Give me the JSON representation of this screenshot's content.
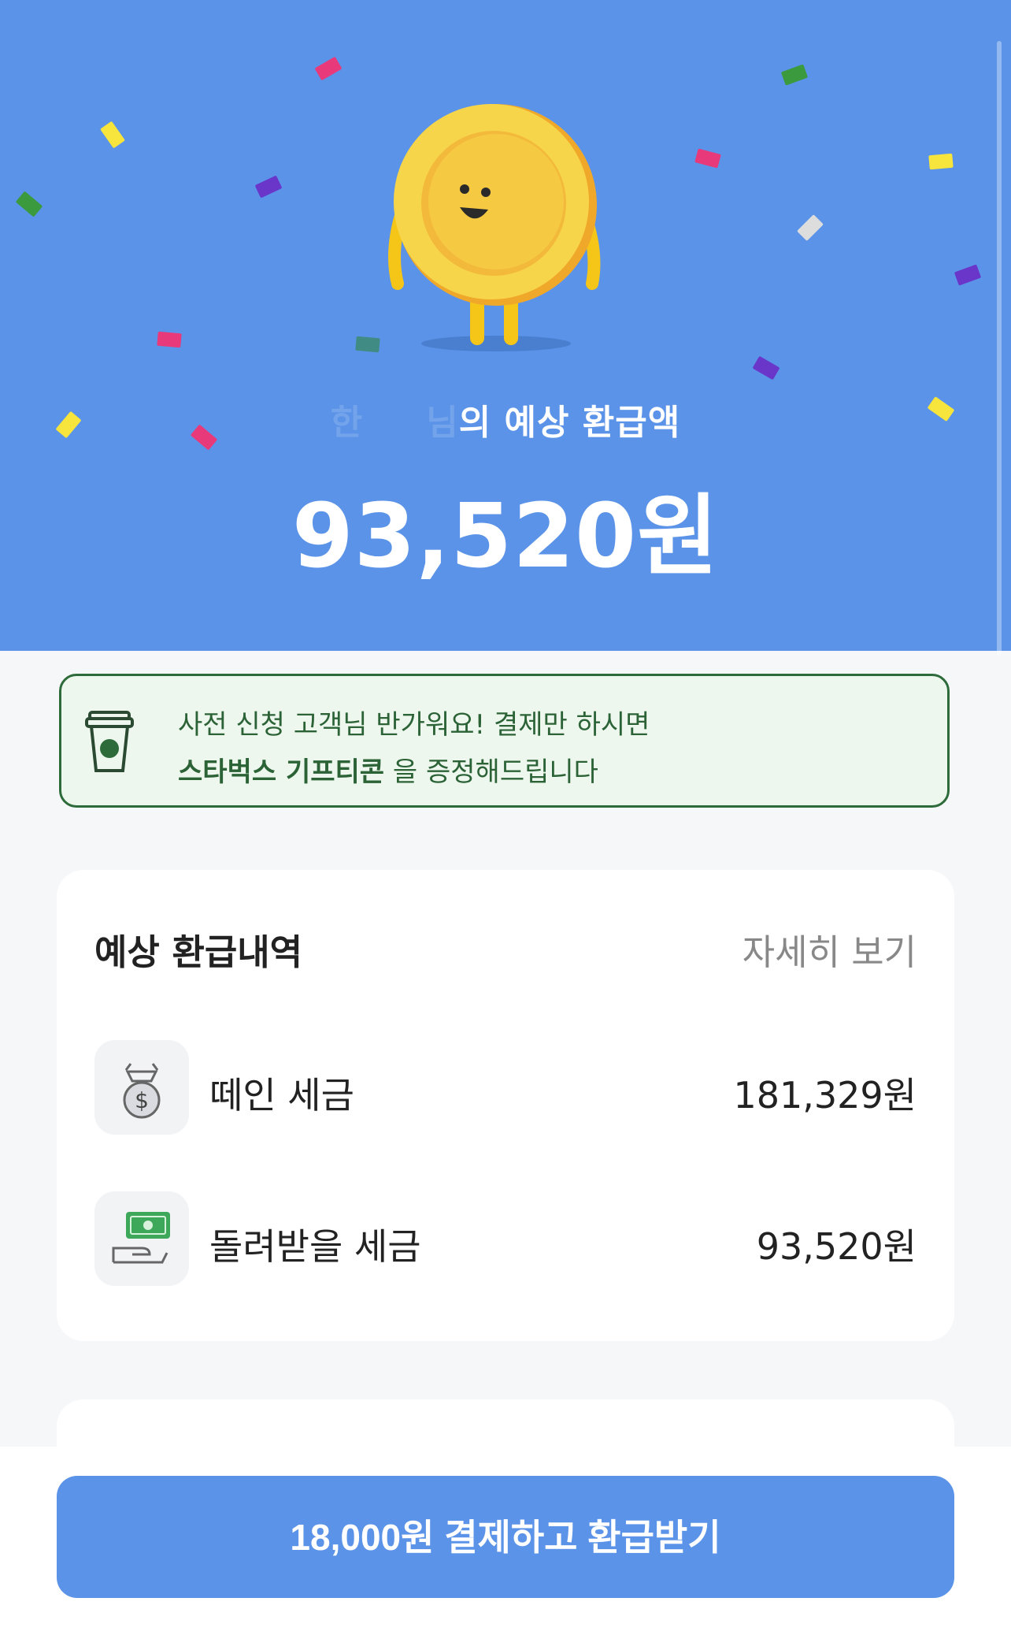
{
  "hero": {
    "subtitle_faded_a": "한",
    "subtitle_faded_b": "님",
    "subtitle_rest": "의 예상 환급액",
    "amount": "93,520원",
    "background_color": "#5b93e8"
  },
  "promo": {
    "line1": "사전 신청 고객님 반가워요! 결제만 하시면",
    "line2_bold": "스타벅스 기프티콘",
    "line2_rest": " 을 증정해드립니다",
    "icon": "coffee-cup-icon",
    "accent_color": "#2e6b3b"
  },
  "refund_card": {
    "title": "예상 환급내역",
    "detail_link": "자세히 보기",
    "rows": [
      {
        "icon": "money-bag-icon",
        "label": "떼인 세금",
        "value": "181,329원"
      },
      {
        "icon": "cash-hand-icon",
        "label": "돌려받을 세금",
        "value": "93,520원"
      }
    ]
  },
  "cta": {
    "label": "18,000원 결제하고 환급받기",
    "color": "#5b93e8"
  }
}
